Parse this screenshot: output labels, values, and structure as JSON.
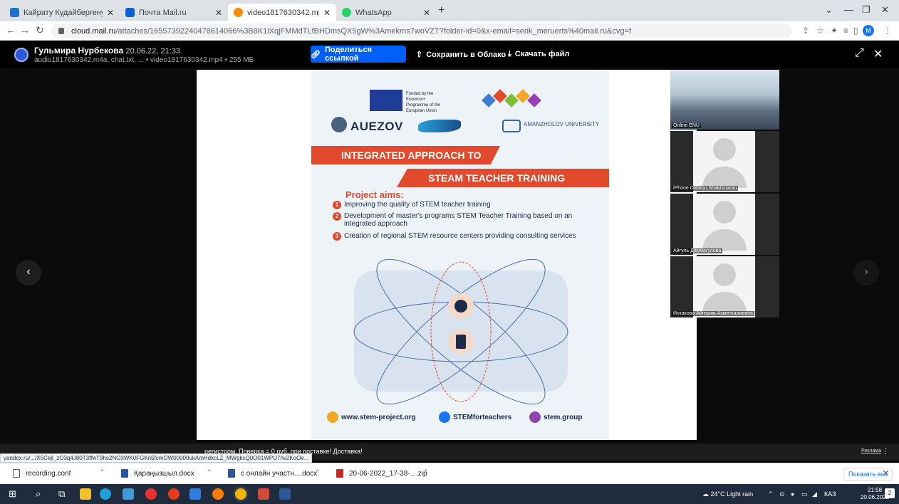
{
  "tabs": [
    {
      "title": "Кайрату Кудайбергену продлили",
      "active": false
    },
    {
      "title": "Почта Mail.ru",
      "active": false
    },
    {
      "title": "video1817630342.mp4 / Облако",
      "active": true
    },
    {
      "title": "WhatsApp",
      "active": false
    }
  ],
  "url": {
    "host": "cloud.mail.ru",
    "path": "/attaches/16557392240478614066%3B8K1iXqjFMMdTLfBHDmsQX5gW%3Amekms7woVZT?folder-id=0&x-email=serik_meruerts%40mail.ru&cvg=f"
  },
  "profile_initial": "M",
  "viewer": {
    "user_name": "Гульмира Нурбекова",
    "timestamp": "20.06.22, 21:33",
    "files": "audio1817630342.m4a, chat.txt, ... • video1817630342.mp4 • 255 МБ",
    "share_label": "Поделиться ссылкой",
    "save_label": "Сохранить в Облако",
    "download_label": "Скачать файл"
  },
  "poster": {
    "eu_funding": "Funded by the Erasmus+ Programme of the European Union",
    "logo_auezov": "AUEZOV",
    "logo_aman": "AMANZHOLOV UNIVERSITY",
    "title_line1": "INTEGRATED APPROACH TO",
    "title_line2": "STEAM TEACHER TRAINING",
    "aims_heading": "Project aims:",
    "aims": [
      {
        "num": "1",
        "text": "Improving the quality of STEM teacher training"
      },
      {
        "num": "2",
        "text": "Development of master's programs STEM Teacher Training based on an integrated approach"
      },
      {
        "num": "3",
        "text": "Creation of regional STEM resource centers providing consulting services"
      }
    ],
    "links": [
      "www.stem-project.org",
      "STEMforteachers",
      "stem.group"
    ]
  },
  "participants": [
    {
      "label": "Online ENU",
      "type": "classroom"
    },
    {
      "label": "iPhone Dilfa/on Shakhmaran",
      "type": "avatar"
    },
    {
      "label": "Айгуль Джумагулова",
      "type": "avatar"
    },
    {
      "label": "Искакова Айгерим Ахметкалиевна",
      "type": "avatar"
    }
  ],
  "ad": {
    "text": "регистром. Поверка = 0 руб. при поставке! Доставка!",
    "label": "Реклама"
  },
  "status_url": "yandex.ru/.../X5Cejl_zO3q4J80T3ffwT9hs2NO3WK0FGKn5fcmOW00000ukAmHdkcLZ_MWgkcQ0O01WPU7hv2KoOe...",
  "downloads": [
    {
      "name": "recording.conf",
      "color": "#ffffff"
    },
    {
      "name": "Қараңызшыл.docx",
      "color": "#2b579a"
    },
    {
      "name": "с онлайн участн....docx",
      "color": "#2b579a"
    },
    {
      "name": "20-06-2022_17-38-....zip",
      "color": "#c62828"
    }
  ],
  "show_all_label": "Показать все",
  "taskbar": {
    "weather": "24°C  Light rain",
    "lang": "КАЗ",
    "time": "21:58",
    "date": "20.06.2022",
    "notifications": "2"
  }
}
